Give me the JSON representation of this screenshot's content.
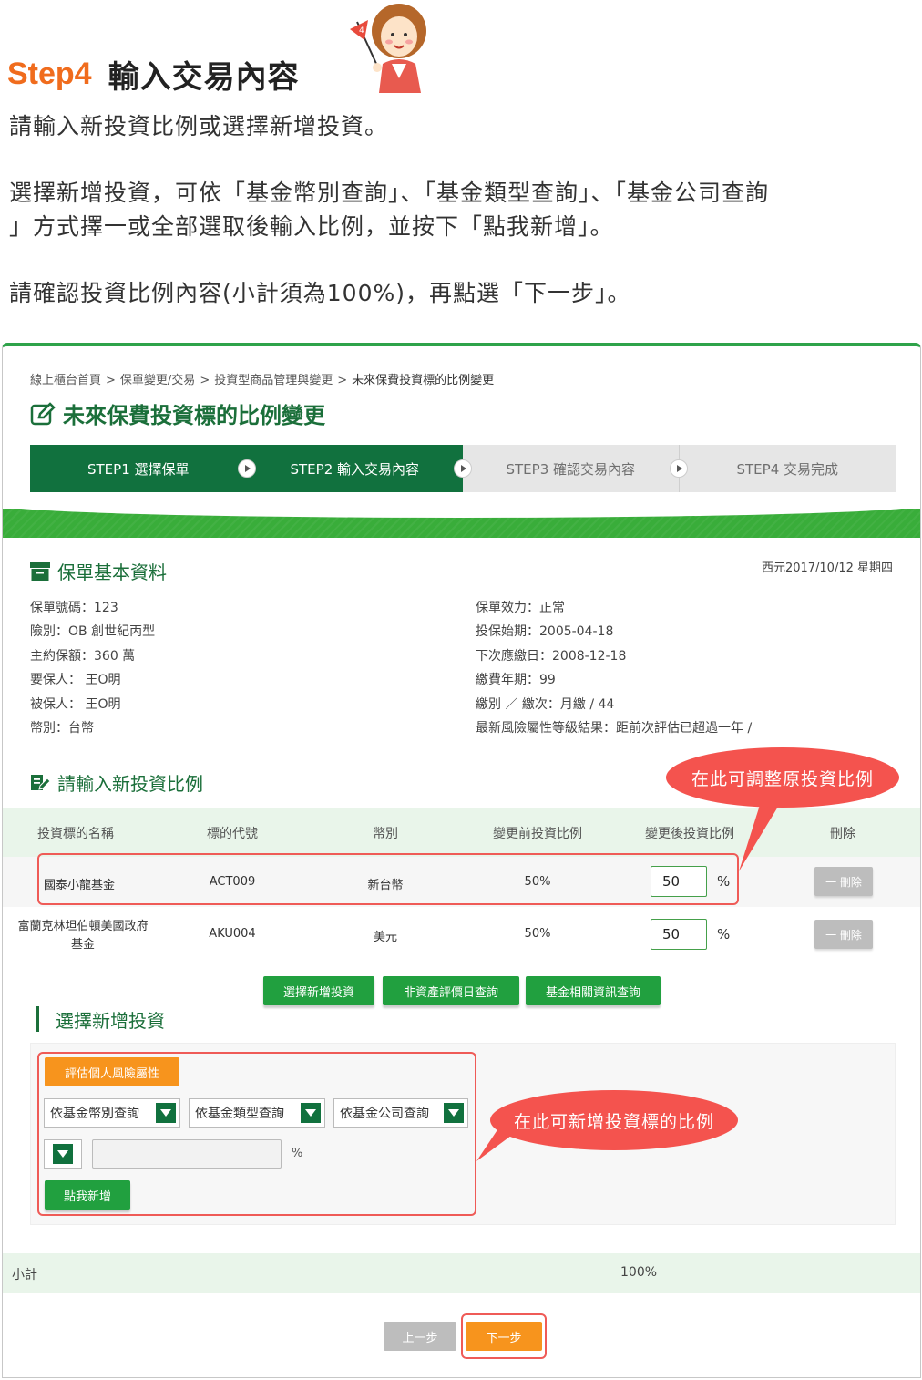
{
  "header": {
    "step_label": "Step4",
    "title": "輸入交易內容",
    "mascot_flag": "4"
  },
  "intro": {
    "line1": "請輸入新投資比例或選擇新增投資。",
    "line2a": "選擇新增投資，可依「基金幣別查詢」、「基金類型查詢」、「基金公司查詢",
    "line2b": "」方式擇一或全部選取後輸入比例，並按下「點我新增」。",
    "line3": "請確認投資比例內容(小計須為100%)，再點選「下一步」。"
  },
  "breadcrumb": [
    "線上櫃台首頁",
    "保單變更/交易",
    "投資型商品管理與變更",
    "未來保費投資標的比例變更"
  ],
  "breadcrumb_sep": ">",
  "page_title": "未來保費投資標的比例變更",
  "steps": [
    {
      "label": "STEP1 選擇保單",
      "active": true
    },
    {
      "label": "STEP2 輸入交易內容",
      "active": true
    },
    {
      "label": "STEP3 確認交易內容",
      "active": false
    },
    {
      "label": "STEP4 交易完成",
      "active": false
    }
  ],
  "policy": {
    "section_title": "保單基本資料",
    "date": "西元2017/10/12 星期四",
    "left": [
      "保單號碼：123",
      "險別：OB 創世紀丙型",
      "主約保額：360 萬",
      "要保人： 王O明",
      "被保人： 王O明",
      "幣別：台幣"
    ],
    "right": [
      "保單效力：正常",
      "投保始期：2005-04-18",
      "下次應繳日：2008-12-18",
      "繳費年期：99",
      "繳別 ／ 繳次：月繳  /  44",
      "最新風險屬性等級結果：距前次評估已超過一年  /"
    ]
  },
  "ratio": {
    "section_title": "請輸入新投資比例",
    "columns": [
      "投資標的名稱",
      "標的代號",
      "幣別",
      "變更前投資比例",
      "變更後投資比例",
      "刪除"
    ],
    "rows": [
      {
        "name": "國泰小龍基金",
        "code": "ACT009",
        "currency": "新台幣",
        "before": "50%",
        "after": "50",
        "unit": "%",
        "delete": "一 刪除"
      },
      {
        "name1": "富蘭克林坦伯頓美國政府",
        "name2": "基金",
        "code": "AKU004",
        "currency": "美元",
        "before": "50%",
        "after": "50",
        "unit": "%",
        "delete": "一 刪除"
      }
    ],
    "bubble": "在此可調整原投資比例"
  },
  "actions": [
    "選擇新增投資",
    "非資產評價日查詢",
    "基金相關資訊查詢"
  ],
  "add": {
    "section_title": "選擇新增投資",
    "risk_button": "評估個人風險屬性",
    "filters": [
      "依基金幣別查詢",
      "依基金類型查詢",
      "依基金公司查詢"
    ],
    "unit": "%",
    "add_button": "點我新增",
    "bubble": "在此可新增投資標的比例"
  },
  "subtotal": {
    "label": "小計",
    "value": "100%"
  },
  "nav": {
    "prev": "上一步",
    "next": "下一步"
  },
  "colors": {
    "brand_green": "#11713e",
    "accent_orange": "#f06c1d",
    "highlight_red": "#ef5b57"
  }
}
